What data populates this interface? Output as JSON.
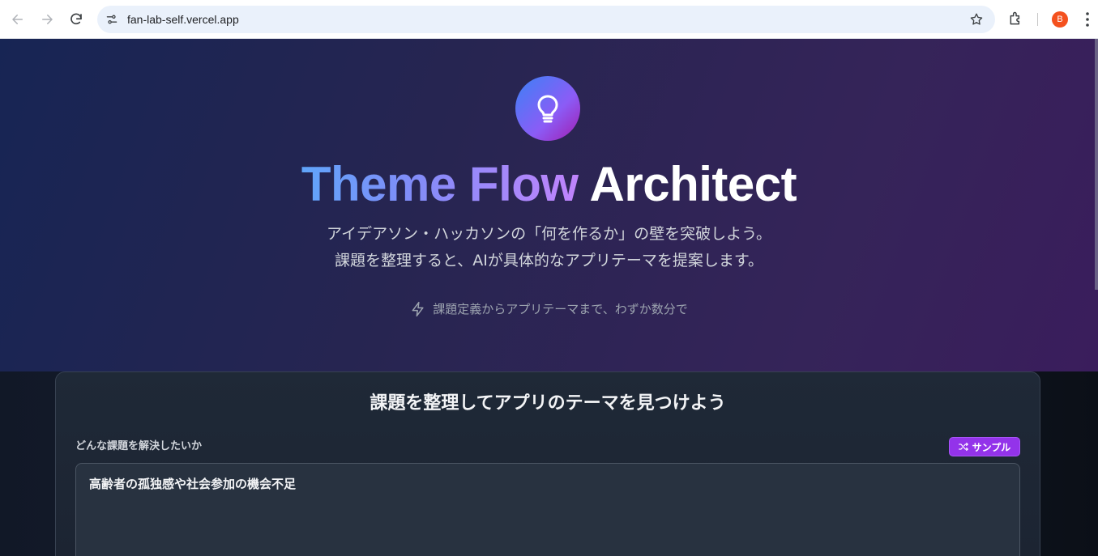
{
  "browser": {
    "url": "fan-lab-self.vercel.app",
    "profile_initial": "B"
  },
  "hero": {
    "title_gradient": "Theme Flow",
    "title_plain": "Architect",
    "subtitle_line1": "アイデアソン・ハッカソンの「何を作るか」の壁を突破しよう。",
    "subtitle_line2": "課題を整理すると、AIが具体的なアプリテーマを提案します。",
    "tagline": "課題定義からアプリテーマまで、わずか数分で"
  },
  "form": {
    "card_title": "課題を整理してアプリのテーマを見つけよう",
    "problem_label": "どんな課題を解決したいか",
    "sample_button": "サンプル",
    "problem_value": "高齢者の孤独感や社会参加の機会不足"
  },
  "colors": {
    "accent": "#9333ea",
    "gradient_start": "#3b82f6",
    "gradient_end": "#a855f7"
  }
}
